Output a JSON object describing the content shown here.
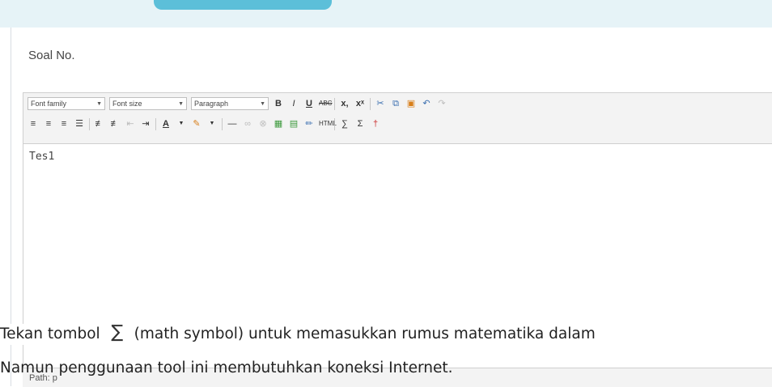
{
  "question": {
    "label": "Soal No."
  },
  "toolbar": {
    "font_family": "Font family",
    "font_size": "Font size",
    "paragraph": "Paragraph",
    "bold": "B",
    "italic": "I",
    "underline": "U",
    "strike": "ABC",
    "subscript": "x,",
    "superscript": "xˣ",
    "summation": "Σ"
  },
  "editor": {
    "content": "Tes1"
  },
  "statusbar": {
    "path": "Path: p"
  },
  "instruction": {
    "prefix": "Tekan tombol",
    "suffix": "(math symbol) untuk memasukkan rumus matematika dalam",
    "line2": "Namun penggunaan tool ini membutuhkan koneksi Internet."
  }
}
